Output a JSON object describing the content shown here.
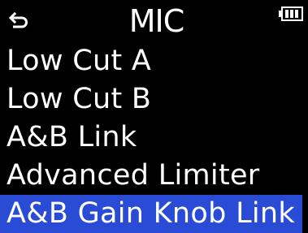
{
  "header": {
    "back_icon": "back-arrow-icon",
    "title": "MIC",
    "battery_icon": "battery-icon",
    "battery_level": 0.75
  },
  "menu": {
    "items": [
      {
        "label": "Low Cut A"
      },
      {
        "label": "Low Cut B"
      },
      {
        "label": "A&B Link"
      },
      {
        "label": "Advanced Limiter"
      },
      {
        "label": "A&B Gain Knob Link",
        "selected": true
      }
    ]
  },
  "colors": {
    "background": "#000000",
    "text": "#ffffff",
    "selection": "#2a4bd6"
  }
}
